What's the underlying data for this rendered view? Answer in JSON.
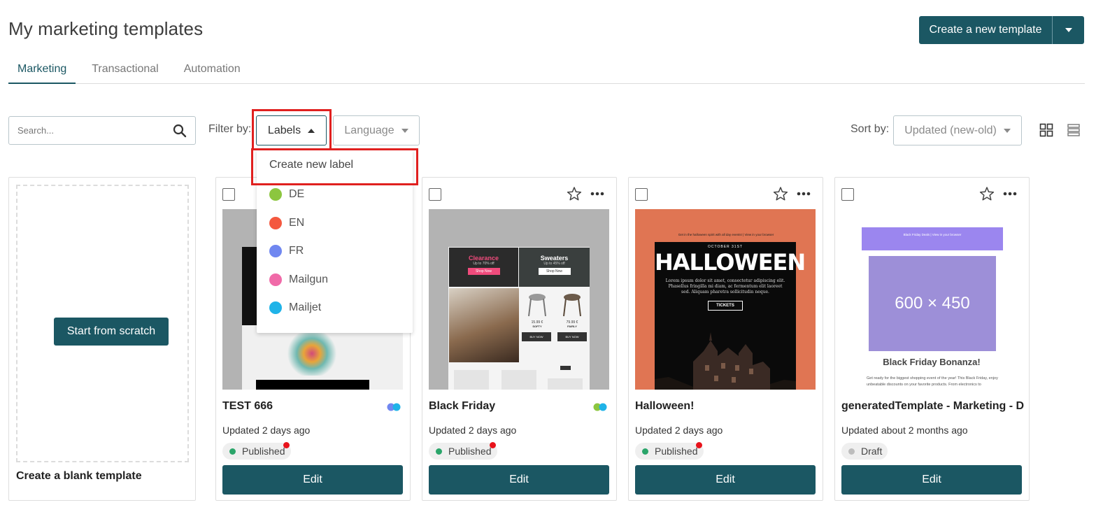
{
  "page": {
    "title": "My marketing templates"
  },
  "header": {
    "create_label": "Create a new template"
  },
  "tabs": [
    {
      "label": "Marketing",
      "active": true
    },
    {
      "label": "Transactional",
      "active": false
    },
    {
      "label": "Automation",
      "active": false
    }
  ],
  "toolbar": {
    "search_placeholder": "Search...",
    "filter_label": "Filter by:",
    "labels_button": "Labels",
    "language_button": "Language",
    "sort_label": "Sort by:",
    "sort_value": "Updated (new-old)"
  },
  "labels_dropdown": {
    "create_label": "Create new label",
    "items": [
      {
        "name": "DE",
        "color": "#8cc63f"
      },
      {
        "name": "EN",
        "color": "#f4583f"
      },
      {
        "name": "FR",
        "color": "#7087f0"
      },
      {
        "name": "Mailgun",
        "color": "#f06aa8"
      },
      {
        "name": "Mailjet",
        "color": "#1fb3e8"
      }
    ]
  },
  "blank_card": {
    "button_label": "Start from scratch",
    "title": "Create a blank template"
  },
  "cards": [
    {
      "name": "TEST 666",
      "updated": "Updated 2 days ago",
      "status": "Published",
      "status_color": "#2aa56a",
      "edit_label": "Edit",
      "label_colors": [
        "#7087f0",
        "#1fb3e8"
      ]
    },
    {
      "name": "Black Friday",
      "updated": "Updated 2 days ago",
      "status": "Published",
      "status_color": "#2aa56a",
      "edit_label": "Edit",
      "label_colors": [
        "#8cc63f",
        "#1fb3e8"
      ],
      "thumb": {
        "clearance": "Clearance",
        "clearance_sub": "Up to 70% off",
        "sweaters": "Sweaters",
        "sweaters_sub": "Up to 45% off",
        "shop_now": "Shop Now",
        "price1": "15.99 €",
        "name1": "SOFTY",
        "price2": "79.99 €",
        "name2": "FAIRLY",
        "buy": "BUY NOW"
      }
    },
    {
      "name": "Halloween!",
      "updated": "Updated 2 days ago",
      "status": "Published",
      "status_color": "#2aa56a",
      "edit_label": "Edit",
      "thumb": {
        "topline": "Get in the halloween spirit with all day events! | View in your browser",
        "date": "OCTOBER 31ST",
        "headline": "HALLOWEEN",
        "body": "Lorem ipsum dolor sit amet, consectetur adipiscing elit. Phasellus fringilla mi diam, ac fermentum elit laoreet sed. Aliquam pharetra sollicitudin neque.",
        "tickets": "TICKETS"
      }
    },
    {
      "name": "generatedTemplate - Marketing - D...",
      "updated": "Updated about 2 months ago",
      "status": "Draft",
      "status_color": "#bdbdbd",
      "edit_label": "Edit",
      "thumb": {
        "banner": "Black Friday Deals | View in your browser",
        "placeholder": "600 × 450",
        "headline": "Black Friday Bonanza!",
        "body": "Get ready for the biggest shopping event of the year! This Black Friday, enjoy unbeatable discounts on your favorite products. From electronics to"
      }
    }
  ]
}
